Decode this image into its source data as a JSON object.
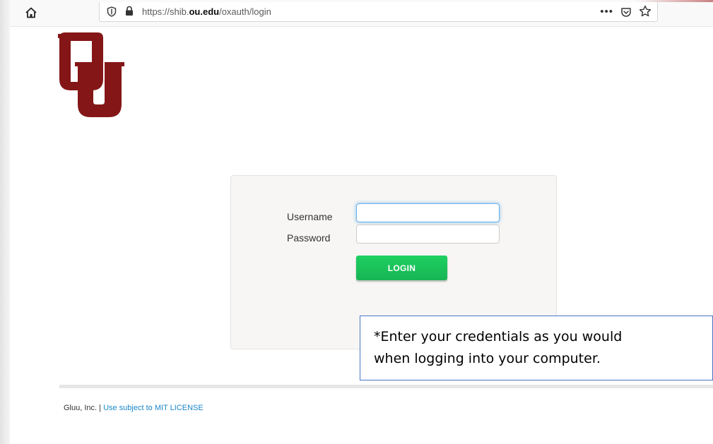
{
  "browser": {
    "url_prefix": "https://shib.",
    "url_domain": "ou.edu",
    "url_path": "/oxauth/login",
    "more_label": "•••"
  },
  "login": {
    "username_label": "Username",
    "password_label": "Password",
    "username_value": "",
    "password_value": "",
    "login_button": "LOGIN"
  },
  "callout": {
    "line1": "*Enter your credentials as you would",
    "line2": "when logging into your computer."
  },
  "footer": {
    "company": "Gluu, Inc. |",
    "license_link": "Use subject to MIT LICENSE"
  },
  "colors": {
    "logo_crimson": "#841617",
    "login_green": "#1ec45a",
    "link_blue": "#1a87c9",
    "callout_border": "#4a74c4"
  },
  "icons": [
    "home-icon",
    "shield-icon",
    "lock-icon",
    "more-icon",
    "pocket-icon",
    "star-icon",
    "ou-logo"
  ]
}
